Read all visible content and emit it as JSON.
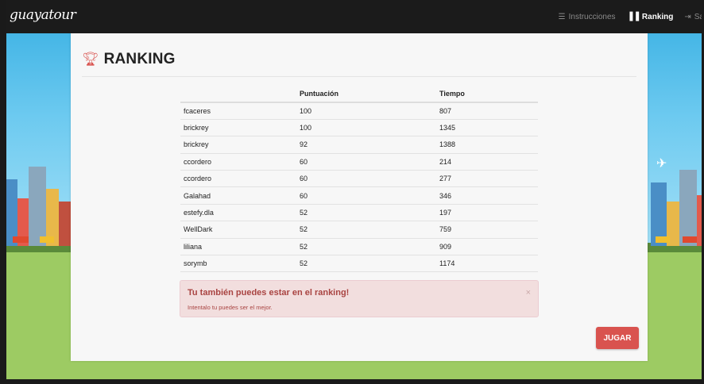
{
  "brand": "guayatour",
  "nav": {
    "instructions": {
      "label": "Instrucciones",
      "icon": "list-icon"
    },
    "ranking": {
      "label": "Ranking",
      "icon": "bar-chart-icon"
    },
    "logout": {
      "label": "Sa",
      "icon": "sign-out-icon"
    }
  },
  "page": {
    "title": "RANKING",
    "icon": "trophy-icon"
  },
  "table": {
    "headers": [
      "",
      "Puntuación",
      "Tiempo"
    ],
    "rows": [
      [
        "fcaceres",
        "100",
        "807"
      ],
      [
        "brickrey",
        "100",
        "1345"
      ],
      [
        "brickrey",
        "92",
        "1388"
      ],
      [
        "ccordero",
        "60",
        "214"
      ],
      [
        "ccordero",
        "60",
        "277"
      ],
      [
        "Galahad",
        "60",
        "346"
      ],
      [
        "estefy.dla",
        "52",
        "197"
      ],
      [
        "WellDark",
        "52",
        "759"
      ],
      [
        "liliana",
        "52",
        "909"
      ],
      [
        "sorymb",
        "52",
        "1174"
      ]
    ]
  },
  "alert": {
    "title": "Tu también puedes estar en el ranking!",
    "text": "Intentalo tu puedes ser el mejor.",
    "close": "×"
  },
  "play_button": "JUGAR",
  "colors": {
    "accent": "#d9534f",
    "navbar": "#1b1b1b",
    "alert_bg": "#f2dede",
    "alert_text": "#a94442"
  }
}
